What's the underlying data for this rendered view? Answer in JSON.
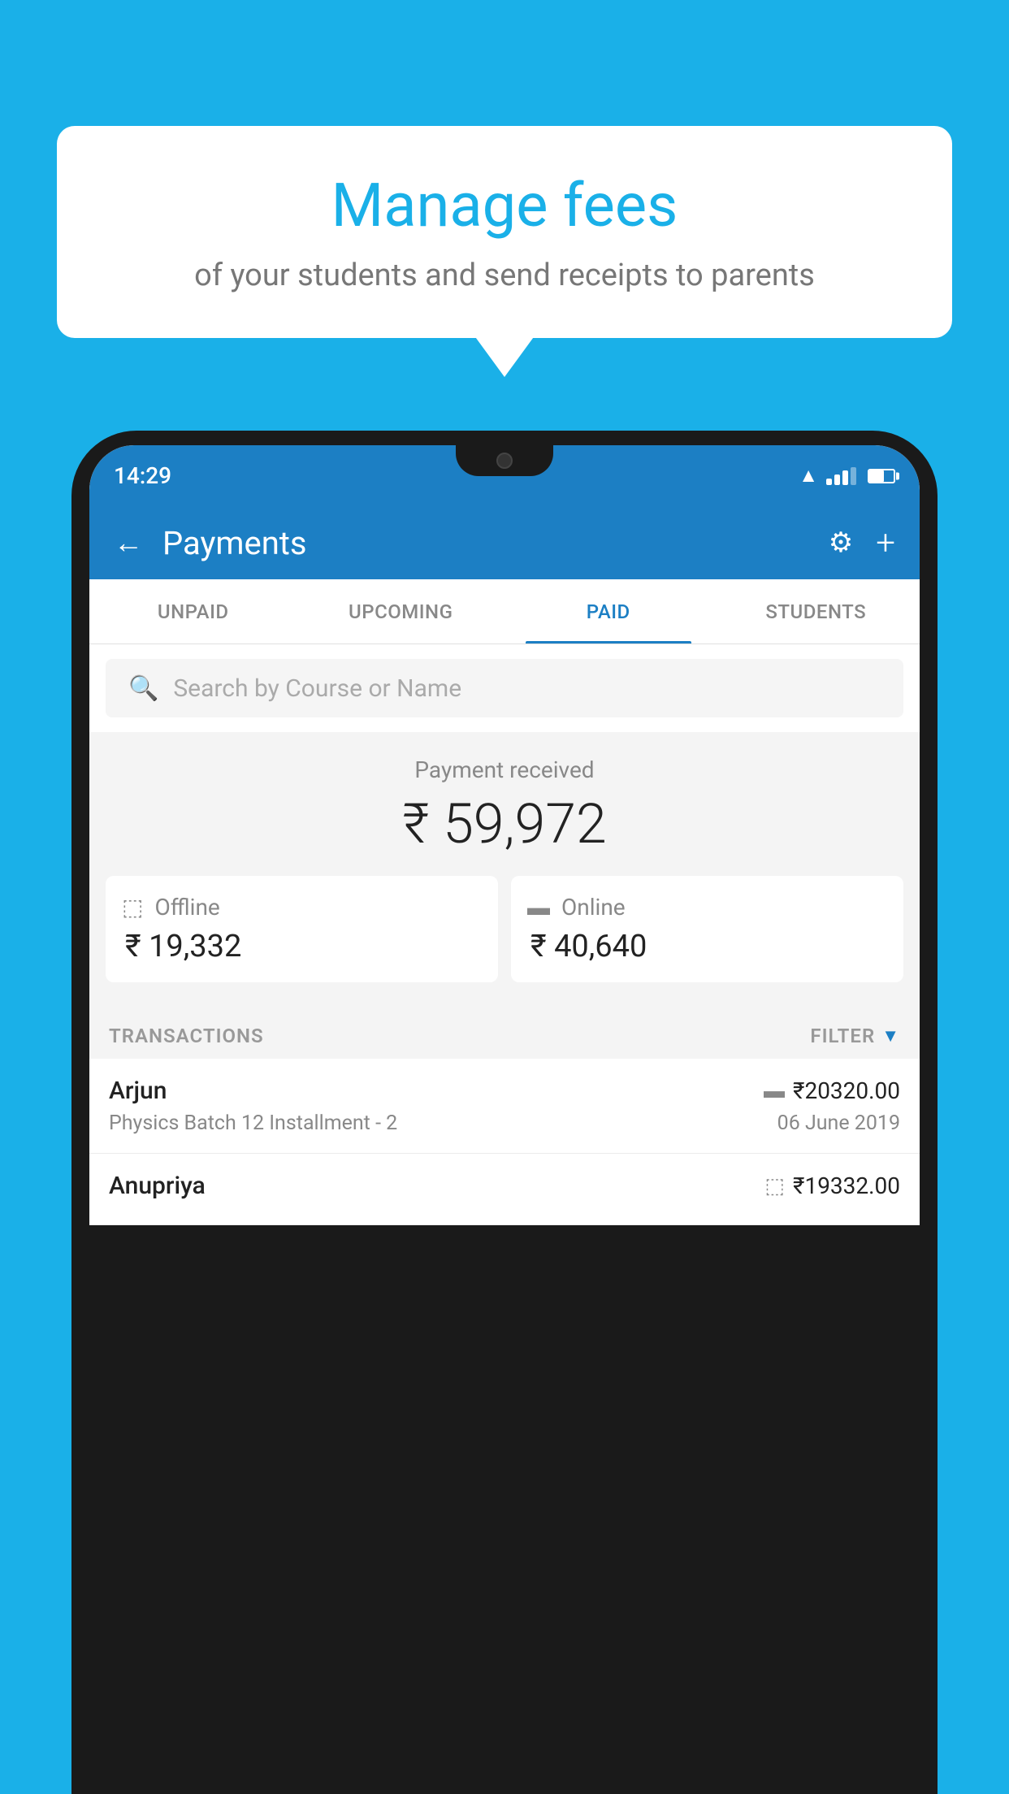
{
  "background_color": "#1ab0e8",
  "speech_bubble": {
    "title": "Manage fees",
    "subtitle": "of your students and send receipts to parents"
  },
  "phone": {
    "time": "14:29",
    "app_bar": {
      "title": "Payments",
      "back_label": "←",
      "settings_label": "⚙",
      "add_label": "+"
    },
    "tabs": [
      {
        "label": "UNPAID",
        "active": false
      },
      {
        "label": "UPCOMING",
        "active": false
      },
      {
        "label": "PAID",
        "active": true
      },
      {
        "label": "STUDENTS",
        "active": false
      }
    ],
    "search": {
      "placeholder": "Search by Course or Name"
    },
    "payment_summary": {
      "label": "Payment received",
      "total": "₹ 59,972",
      "offline": {
        "type": "Offline",
        "amount": "₹ 19,332"
      },
      "online": {
        "type": "Online",
        "amount": "₹ 40,640"
      }
    },
    "transactions_label": "TRANSACTIONS",
    "filter_label": "FILTER",
    "transactions": [
      {
        "name": "Arjun",
        "amount": "₹20320.00",
        "course": "Physics Batch 12 Installment - 2",
        "date": "06 June 2019",
        "payment_type": "online"
      },
      {
        "name": "Anupriya",
        "amount": "₹19332.00",
        "course": "",
        "date": "",
        "payment_type": "offline"
      }
    ]
  }
}
